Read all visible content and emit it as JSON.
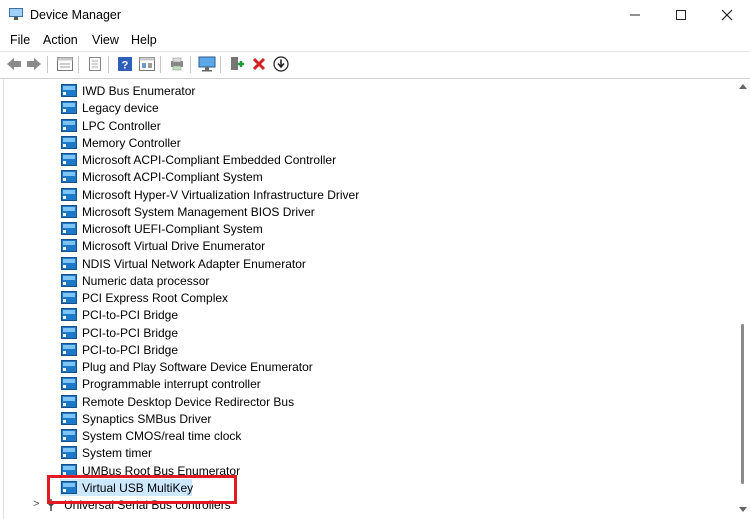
{
  "window": {
    "title": "Device Manager"
  },
  "menu": [
    "File",
    "Action",
    "View",
    "Help"
  ],
  "colors": {
    "selection": "#cce8ff",
    "highlight_border": "#e01b24",
    "device_icon": "#1e78c8",
    "delete_icon": "#d42020"
  },
  "toolbar_icons": [
    "back-icon",
    "forward-icon",
    "properties-list-icon",
    "update-icon",
    "help-icon",
    "console-icon",
    "print-icon",
    "monitor-icon",
    "enable-device-icon",
    "delete-icon",
    "download-icon"
  ],
  "devices": [
    "IWD Bus Enumerator",
    "Legacy device",
    "LPC Controller",
    "Memory Controller",
    "Microsoft ACPI-Compliant Embedded Controller",
    "Microsoft ACPI-Compliant System",
    "Microsoft Hyper-V Virtualization Infrastructure Driver",
    "Microsoft System Management BIOS Driver",
    "Microsoft UEFI-Compliant System",
    "Microsoft Virtual Drive Enumerator",
    "NDIS Virtual Network Adapter Enumerator",
    "Numeric data processor",
    "PCI Express Root Complex",
    "PCI-to-PCI Bridge",
    "PCI-to-PCI Bridge",
    "PCI-to-PCI Bridge",
    "Plug and Play Software Device Enumerator",
    "Programmable interrupt controller",
    "Remote Desktop Device Redirector Bus",
    "Synaptics SMBus Driver",
    "System CMOS/real time clock",
    "System timer",
    "UMBus Root Bus Enumerator",
    "Virtual USB MultiKey"
  ],
  "selected_device": "Virtual USB MultiKey",
  "next_category": {
    "label": "Universal Serial Bus controllers",
    "expander": ">"
  }
}
